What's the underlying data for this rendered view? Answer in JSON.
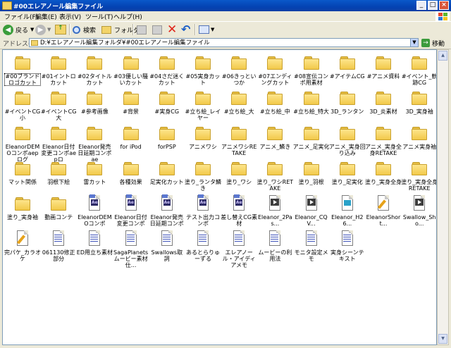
{
  "window": {
    "title": "#00エレアノール編集ファイル"
  },
  "titlebar_buttons": {
    "minimize": "_",
    "maximize": "□",
    "close": "×"
  },
  "menu": [
    "ファイル(F)",
    "編集(E)",
    "表示(V)",
    "ツール(T)",
    "ヘルプ(H)"
  ],
  "toolbar": {
    "back": "戻る",
    "search": "検索",
    "folders": "フォルダ"
  },
  "address": {
    "label": "アドレス(D)",
    "path": "D:¥エレアノール編集フォルダ¥#00エレアノール編集ファイル",
    "go": "移動"
  },
  "items": [
    {
      "label": "#00ブランドロゴカット",
      "type": "folder",
      "col": 0,
      "row": 0,
      "selected": true
    },
    {
      "label": "#01イントロカット",
      "type": "folder",
      "col": 1,
      "row": 0
    },
    {
      "label": "#02タイトルカット",
      "type": "folder",
      "col": 2,
      "row": 0
    },
    {
      "label": "#03優しい騒いカット",
      "type": "folder",
      "col": 3,
      "row": 0
    },
    {
      "label": "#04さだ迷くカット",
      "type": "folder",
      "col": 4,
      "row": 0
    },
    {
      "label": "#05実身カット",
      "type": "folder",
      "col": 5,
      "row": 0
    },
    {
      "label": "#06きっといつか",
      "type": "folder",
      "col": 6,
      "row": 0
    },
    {
      "label": "#07エンディングカット",
      "type": "folder",
      "col": 7,
      "row": 0
    },
    {
      "label": "#08宣伝コンポ用素材",
      "type": "folder",
      "col": 8,
      "row": 0
    },
    {
      "label": "#アイテムCG",
      "type": "folder",
      "col": 9,
      "row": 0
    },
    {
      "label": "#アニメ資料",
      "type": "folder",
      "col": 10,
      "row": 0
    },
    {
      "label": "#イベント_軌跡CG",
      "type": "folder",
      "col": 11,
      "row": 0
    },
    {
      "label": "#イベントCG小",
      "type": "folder",
      "col": 0,
      "row": 1
    },
    {
      "label": "#イベントCG大",
      "type": "folder",
      "col": 1,
      "row": 1
    },
    {
      "label": "#参考画像",
      "type": "folder",
      "col": 2,
      "row": 1
    },
    {
      "label": "#背景",
      "type": "folder",
      "col": 3,
      "row": 1
    },
    {
      "label": "#実身CG",
      "type": "folder",
      "col": 4,
      "row": 1
    },
    {
      "label": "#立ち絵_レイヤー",
      "type": "folder",
      "col": 5,
      "row": 1
    },
    {
      "label": "#立ち絵_大",
      "type": "folder",
      "col": 6,
      "row": 1
    },
    {
      "label": "#立ち絵_中",
      "type": "folder",
      "col": 7,
      "row": 1
    },
    {
      "label": "#立ち絵_特大",
      "type": "folder",
      "col": 8,
      "row": 1
    },
    {
      "label": "3D_ランタン",
      "type": "folder",
      "col": 9,
      "row": 1
    },
    {
      "label": "3D_炎素材",
      "type": "folder",
      "col": 10,
      "row": 1
    },
    {
      "label": "3D_実身袖",
      "type": "folder",
      "col": 11,
      "row": 1
    },
    {
      "label": "EleanorDEMOコンポaepログ",
      "type": "folder",
      "col": 0,
      "row": 2
    },
    {
      "label": "Eleanor日付変更コンポaepロ",
      "type": "folder",
      "col": 1,
      "row": 2
    },
    {
      "label": "Eleanor発売日延期コンポae",
      "type": "folder",
      "col": 2,
      "row": 2
    },
    {
      "label": "for iPod",
      "type": "folder",
      "col": 3,
      "row": 2
    },
    {
      "label": "forPSP",
      "type": "folder",
      "col": 4,
      "row": 2
    },
    {
      "label": "アニメワシ",
      "type": "folder",
      "col": 5,
      "row": 2
    },
    {
      "label": "アニメワシRETAKE",
      "type": "folder",
      "col": 6,
      "row": 2
    },
    {
      "label": "アニメ_鱗き",
      "type": "folder",
      "col": 7,
      "row": 2
    },
    {
      "label": "アニメ_足実化",
      "type": "folder",
      "col": 8,
      "row": 2
    },
    {
      "label": "アニメ_実身回り込み",
      "type": "folder",
      "col": 9,
      "row": 2
    },
    {
      "label": "アニメ_実身全身RETAKE",
      "type": "folder",
      "col": 10,
      "row": 2
    },
    {
      "label": "アニメ実身袖",
      "type": "folder",
      "col": 11,
      "row": 2
    },
    {
      "label": "マット関係",
      "type": "folder",
      "col": 0,
      "row": 3
    },
    {
      "label": "羽根下絵",
      "type": "folder",
      "col": 1,
      "row": 3
    },
    {
      "label": "雷カット",
      "type": "folder",
      "col": 2,
      "row": 3
    },
    {
      "label": "各種効果",
      "type": "folder",
      "col": 3,
      "row": 3
    },
    {
      "label": "足実化カット",
      "type": "folder",
      "col": 4,
      "row": 3
    },
    {
      "label": "塗り_ランタ鱗き",
      "type": "folder",
      "col": 5,
      "row": 3
    },
    {
      "label": "塗り_ワシ",
      "type": "folder",
      "col": 6,
      "row": 3
    },
    {
      "label": "塗り_ワシRETAKE",
      "type": "folder",
      "col": 7,
      "row": 3
    },
    {
      "label": "塗り_羽根",
      "type": "folder",
      "col": 8,
      "row": 3
    },
    {
      "label": "塗り_足実化",
      "type": "folder",
      "col": 9,
      "row": 3
    },
    {
      "label": "塗り_実身全身",
      "type": "folder",
      "col": 10,
      "row": 3
    },
    {
      "label": "塗り_実身全身RETAKE",
      "type": "folder",
      "col": 11,
      "row": 3
    },
    {
      "label": "塗り_実身袖",
      "type": "folder",
      "col": 0,
      "row": 4
    },
    {
      "label": "動画コンテ",
      "type": "folder",
      "col": 1,
      "row": 4
    },
    {
      "label": "EleanorDEMOコンポ",
      "type": "ae",
      "col": 2,
      "row": 4
    },
    {
      "label": "Eleanor日付変更コンポ",
      "type": "ae",
      "col": 3,
      "row": 4
    },
    {
      "label": "Eleanor発売日延期コンポ",
      "type": "ae",
      "col": 4,
      "row": 4
    },
    {
      "label": "テスト出力コンポ",
      "type": "ae",
      "col": 5,
      "row": 4
    },
    {
      "label": "差し替えCG素材",
      "type": "ae",
      "col": 6,
      "row": 4
    },
    {
      "label": "Eleanor_2Pas...",
      "type": "video",
      "col": 7,
      "row": 4
    },
    {
      "label": "Eleanor_CQV...",
      "type": "video",
      "col": 8,
      "row": 4
    },
    {
      "label": "Eleanor_H26...",
      "type": "mp4",
      "col": 9,
      "row": 4
    },
    {
      "label": "EleanorShort...",
      "type": "pencil",
      "col": 10,
      "row": 4
    },
    {
      "label": "Swallow_Sho...",
      "type": "video",
      "col": 11,
      "row": 4
    },
    {
      "label": "完パケ_カラオケ",
      "type": "pencil",
      "col": 0,
      "row": 5
    },
    {
      "label": "061130修正部分",
      "type": "text",
      "col": 1,
      "row": 5
    },
    {
      "label": "ED用立ち素材",
      "type": "text",
      "col": 2,
      "row": 5
    },
    {
      "label": "SagaPlanetsムービー素材仕...",
      "type": "text",
      "col": 3,
      "row": 5
    },
    {
      "label": "Swallows取詞",
      "type": "text",
      "col": 4,
      "row": 5
    },
    {
      "label": "あるとらりゅーずる",
      "type": "text",
      "col": 5,
      "row": 5
    },
    {
      "label": "エレアノール・アイディアメモ",
      "type": "text",
      "col": 6,
      "row": 5
    },
    {
      "label": "ムービーの利用法",
      "type": "text",
      "col": 7,
      "row": 5
    },
    {
      "label": "モニタ設定メモ",
      "type": "text",
      "col": 8,
      "row": 5
    },
    {
      "label": "実身シーンテキスト",
      "type": "text",
      "col": 9,
      "row": 5
    }
  ]
}
